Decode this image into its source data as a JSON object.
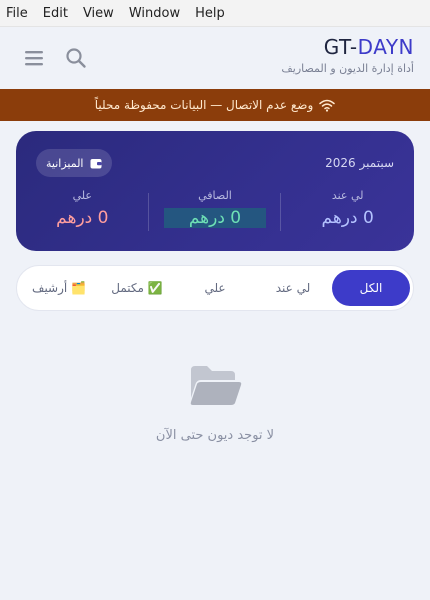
{
  "menubar": {
    "items": [
      "File",
      "Edit",
      "View",
      "Window",
      "Help"
    ]
  },
  "header": {
    "brand_part1": "GT-",
    "brand_part2": "DAYN",
    "subtitle": "أداة إدارة الديون و المصاريف",
    "menu_icon": "hamburger-icon",
    "search_icon": "search-icon"
  },
  "banner": {
    "text": "وضع عدم الاتصال — البيانات محفوظة محلياً",
    "icon": "wifi-icon"
  },
  "card": {
    "month": "سبتمبر 2026",
    "budget_label": "الميزانية",
    "stats": [
      {
        "label": "لي عند",
        "value": "0 درهم"
      },
      {
        "label": "الصافي",
        "value": "0 درهم"
      },
      {
        "label": "علي",
        "value": "0 درهم"
      }
    ]
  },
  "tabs": [
    {
      "label": "الكل",
      "active": true
    },
    {
      "label": "لي عند",
      "active": false
    },
    {
      "label": "علي",
      "active": false
    },
    {
      "label": "✅ مكتمل",
      "active": false
    },
    {
      "label": "🗂️ أرشيف",
      "active": false
    }
  ],
  "empty": {
    "text": "لا توجد ديون حتى الآن",
    "icon": "folder-open-icon"
  },
  "colors": {
    "accent": "#3d3bc9",
    "banner": "#8b3d0b",
    "card": "#2f2d88"
  }
}
